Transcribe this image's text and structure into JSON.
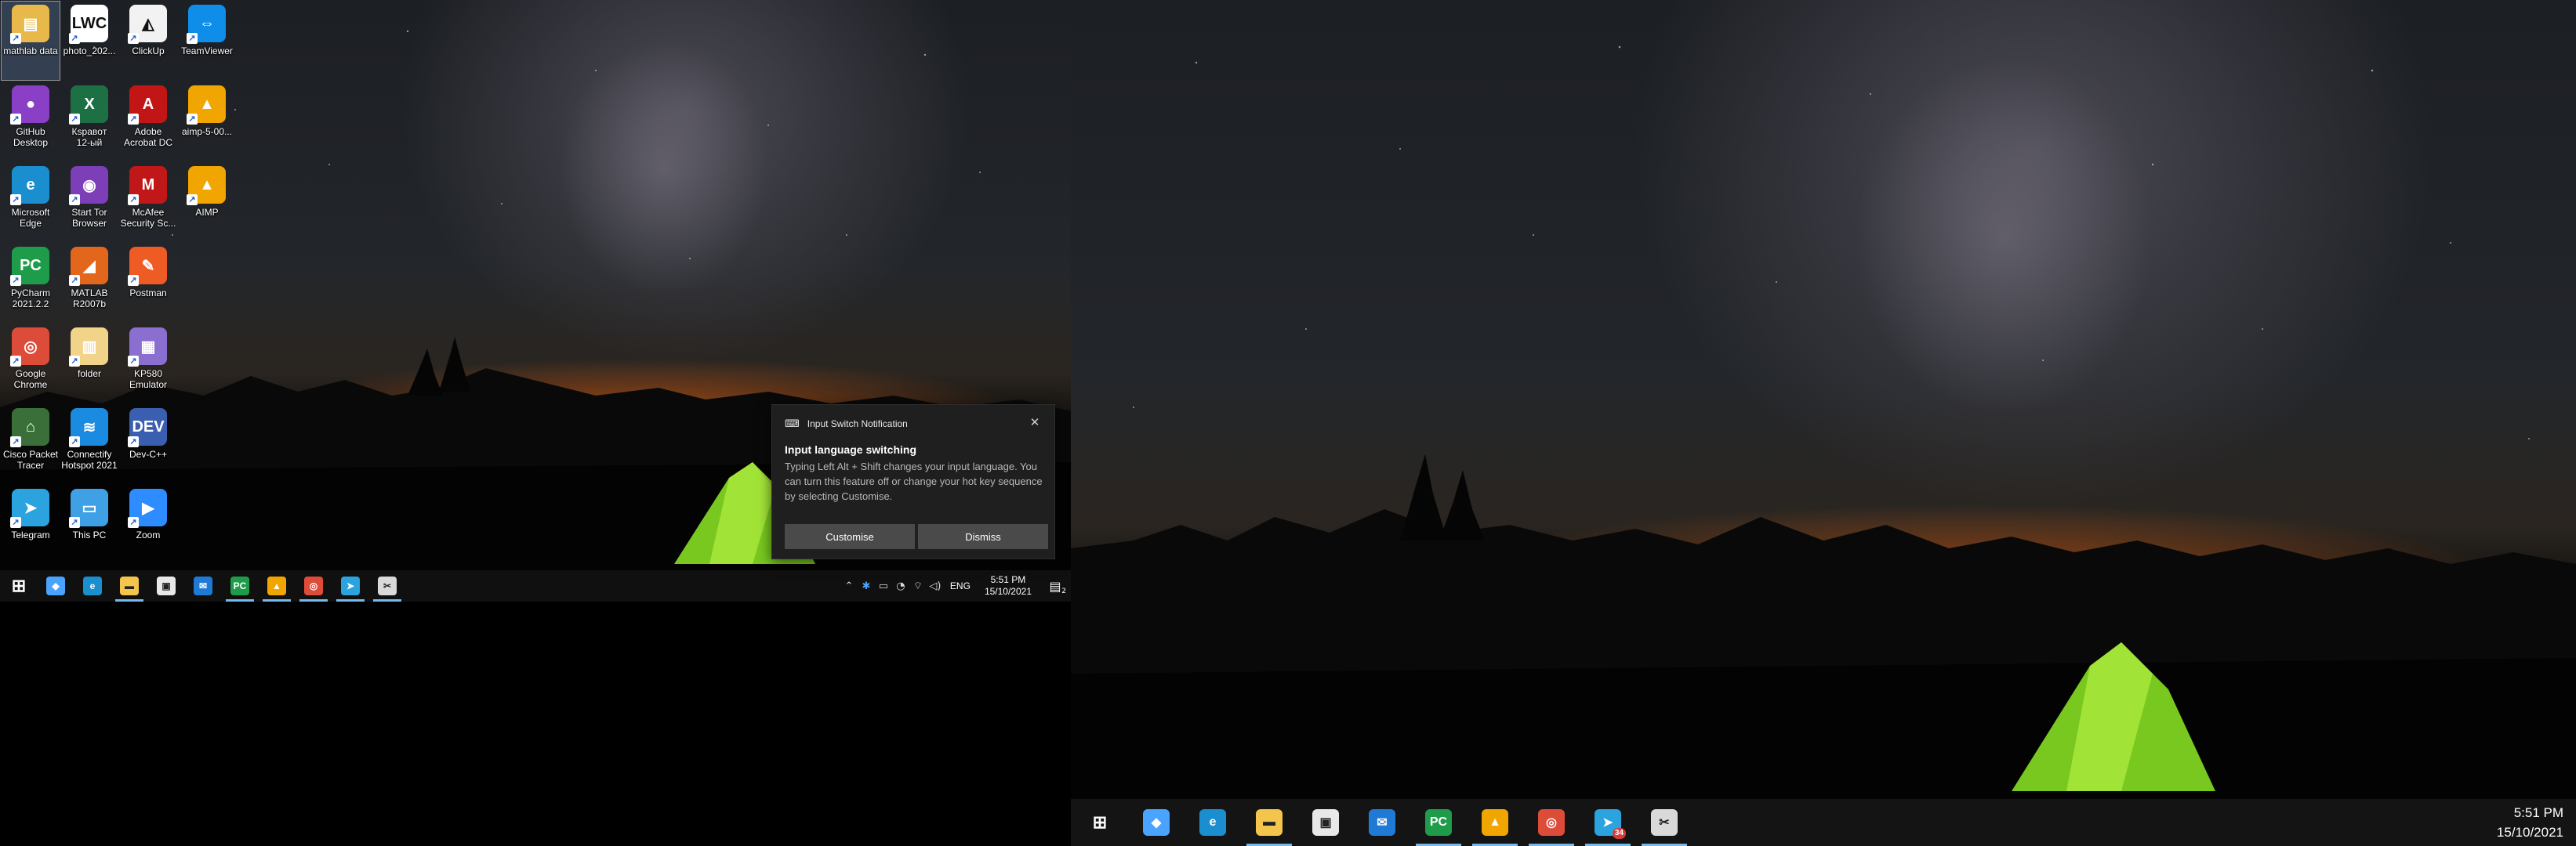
{
  "desktop_icons": [
    {
      "label": "mathlab data",
      "icon": "folder-icon",
      "color": "#e8b94a",
      "glyph": "▤"
    },
    {
      "label": "photo_202...",
      "icon": "image-file-icon",
      "color": "#ffffff",
      "glyph": "LWC"
    },
    {
      "label": "ClickUp",
      "icon": "clickup-icon",
      "color": "#f2f2f2",
      "glyph": "◭"
    },
    {
      "label": "TeamViewer",
      "icon": "teamviewer-icon",
      "color": "#0e8ee9",
      "glyph": "⇔"
    },
    {
      "label": "GitHub\nDesktop",
      "icon": "github-desktop-icon",
      "color": "#8a3fc7",
      "glyph": "●"
    },
    {
      "label": "Кspaвoт\n12-ый",
      "icon": "excel-file-icon",
      "color": "#1d7044",
      "glyph": "X"
    },
    {
      "label": "Adobe\nAcrobat DC",
      "icon": "acrobat-icon",
      "color": "#c21616",
      "glyph": "A"
    },
    {
      "label": "aimp-5-00...",
      "icon": "aimp-installer-icon",
      "color": "#f0a500",
      "glyph": "▲"
    },
    {
      "label": "Microsoft\nEdge",
      "icon": "edge-icon",
      "color": "#1a8ecf",
      "glyph": "e"
    },
    {
      "label": "Start Tor\nBrowser",
      "icon": "tor-browser-icon",
      "color": "#7d3fb8",
      "glyph": "◉"
    },
    {
      "label": "McAfee\nSecurity Sc...",
      "icon": "mcafee-icon",
      "color": "#c01818",
      "glyph": "M"
    },
    {
      "label": "AIMP",
      "icon": "aimp-icon",
      "color": "#f0a500",
      "glyph": "▲"
    },
    {
      "label": "PyCharm\n2021.2.2",
      "icon": "pycharm-icon",
      "color": "#1f9c4a",
      "glyph": "PC"
    },
    {
      "label": "MATLAB\nR2007b",
      "icon": "matlab-icon",
      "color": "#e2661b",
      "glyph": "◢"
    },
    {
      "label": "Postman",
      "icon": "postman-icon",
      "color": "#ef5b25",
      "glyph": "✎"
    },
    {
      "label": "",
      "icon": "empty-slot",
      "color": "transparent",
      "glyph": ""
    },
    {
      "label": "Google\nChrome",
      "icon": "chrome-icon",
      "color": "#dd4b39",
      "glyph": "◎"
    },
    {
      "label": "folder",
      "icon": "folder-file-icon",
      "color": "#f1d38a",
      "glyph": "▥"
    },
    {
      "label": "KP580\nEmulator",
      "icon": "kp580-emulator-icon",
      "color": "#8a6fd0",
      "glyph": "▦"
    },
    {
      "label": "",
      "icon": "empty-slot",
      "color": "transparent",
      "glyph": ""
    },
    {
      "label": "Cisco Packet\nTracer",
      "icon": "packet-tracer-icon",
      "color": "#3a6f3a",
      "glyph": "⌂"
    },
    {
      "label": "Connectify\nHotspot 2021",
      "icon": "connectify-icon",
      "color": "#1a8be0",
      "glyph": "≋"
    },
    {
      "label": "Dev-C++",
      "icon": "devcpp-icon",
      "color": "#3b5fb0",
      "glyph": "DEV"
    },
    {
      "label": "",
      "icon": "empty-slot",
      "color": "transparent",
      "glyph": ""
    },
    {
      "label": "Telegram",
      "icon": "telegram-icon",
      "color": "#2aa3df",
      "glyph": "➤"
    },
    {
      "label": "This PC",
      "icon": "this-pc-icon",
      "color": "#3fa0e6",
      "glyph": "▭"
    },
    {
      "label": "Zoom",
      "icon": "zoom-icon",
      "color": "#2d8cff",
      "glyph": "▶"
    }
  ],
  "taskbar_left": {
    "apps": [
      {
        "name": "start",
        "icon": "windows-start-icon",
        "color": "#ffffff",
        "glyph": "⊞",
        "active": false
      },
      {
        "name": "connectify",
        "icon": "connectify-taskbar-icon",
        "color": "#4aa3ff",
        "glyph": "◆",
        "active": false
      },
      {
        "name": "edge",
        "icon": "edge-icon",
        "color": "#1a8ecf",
        "glyph": "e",
        "active": false
      },
      {
        "name": "file-explorer",
        "icon": "file-explorer-icon",
        "color": "#f3c54c",
        "glyph": "▬",
        "active": true
      },
      {
        "name": "store",
        "icon": "store-icon",
        "color": "#e8e8e8",
        "glyph": "▣",
        "active": false
      },
      {
        "name": "mail",
        "icon": "mail-icon",
        "color": "#1f7ad6",
        "glyph": "✉",
        "active": false
      },
      {
        "name": "pycharm",
        "icon": "pycharm-icon",
        "color": "#1f9c4a",
        "glyph": "PC",
        "active": true
      },
      {
        "name": "aimp",
        "icon": "aimp-icon",
        "color": "#f0a500",
        "glyph": "▲",
        "active": true
      },
      {
        "name": "chrome",
        "icon": "chrome-icon",
        "color": "#dd4b39",
        "glyph": "◎",
        "active": true
      },
      {
        "name": "telegram",
        "icon": "telegram-icon",
        "color": "#2aa3df",
        "glyph": "➤",
        "active": true
      },
      {
        "name": "snipping",
        "icon": "snipping-tool-icon",
        "color": "#d9d9d9",
        "glyph": "✂",
        "active": true
      }
    ],
    "tray": {
      "language": "ENG",
      "time": "5:51 PM",
      "date": "15/10/2021",
      "notification_count": "2"
    }
  },
  "toast": {
    "header": "Input Switch Notification",
    "title": "Input language switching",
    "body": "Typing Left Alt + Shift changes your input language. You can turn this feature off or change your hot key sequence by selecting Customise.",
    "customise_label": "Customise",
    "dismiss_label": "Dismiss"
  },
  "taskbar_right": {
    "apps": [
      {
        "name": "start",
        "icon": "windows-start-icon",
        "color": "#ffffff",
        "glyph": "⊞",
        "active": false,
        "badge": ""
      },
      {
        "name": "connectify",
        "icon": "connectify-taskbar-icon",
        "color": "#4aa3ff",
        "glyph": "◆",
        "active": false,
        "badge": ""
      },
      {
        "name": "edge",
        "icon": "edge-icon",
        "color": "#1a8ecf",
        "glyph": "e",
        "active": false,
        "badge": ""
      },
      {
        "name": "file-explorer",
        "icon": "file-explorer-icon",
        "color": "#f3c54c",
        "glyph": "▬",
        "active": true,
        "badge": ""
      },
      {
        "name": "store",
        "icon": "store-icon",
        "color": "#e8e8e8",
        "glyph": "▣",
        "active": false,
        "badge": ""
      },
      {
        "name": "mail",
        "icon": "mail-icon",
        "color": "#1f7ad6",
        "glyph": "✉",
        "active": false,
        "badge": ""
      },
      {
        "name": "pycharm",
        "icon": "pycharm-icon",
        "color": "#1f9c4a",
        "glyph": "PC",
        "active": true,
        "badge": ""
      },
      {
        "name": "aimp",
        "icon": "aimp-icon",
        "color": "#f0a500",
        "glyph": "▲",
        "active": true,
        "badge": ""
      },
      {
        "name": "chrome",
        "icon": "chrome-icon",
        "color": "#dd4b39",
        "glyph": "◎",
        "active": true,
        "badge": ""
      },
      {
        "name": "telegram",
        "icon": "telegram-icon",
        "color": "#2aa3df",
        "glyph": "➤",
        "active": true,
        "badge": "34"
      },
      {
        "name": "snipping",
        "icon": "snipping-tool-icon",
        "color": "#d9d9d9",
        "glyph": "✂",
        "active": true,
        "badge": ""
      }
    ],
    "clock": {
      "time": "5:51 PM",
      "date": "15/10/2021"
    }
  },
  "colors": {
    "accent": "#76b9ed",
    "taskbar": "#101010",
    "toast_bg": "#1f1f1f",
    "button": "#4a4a4a"
  }
}
